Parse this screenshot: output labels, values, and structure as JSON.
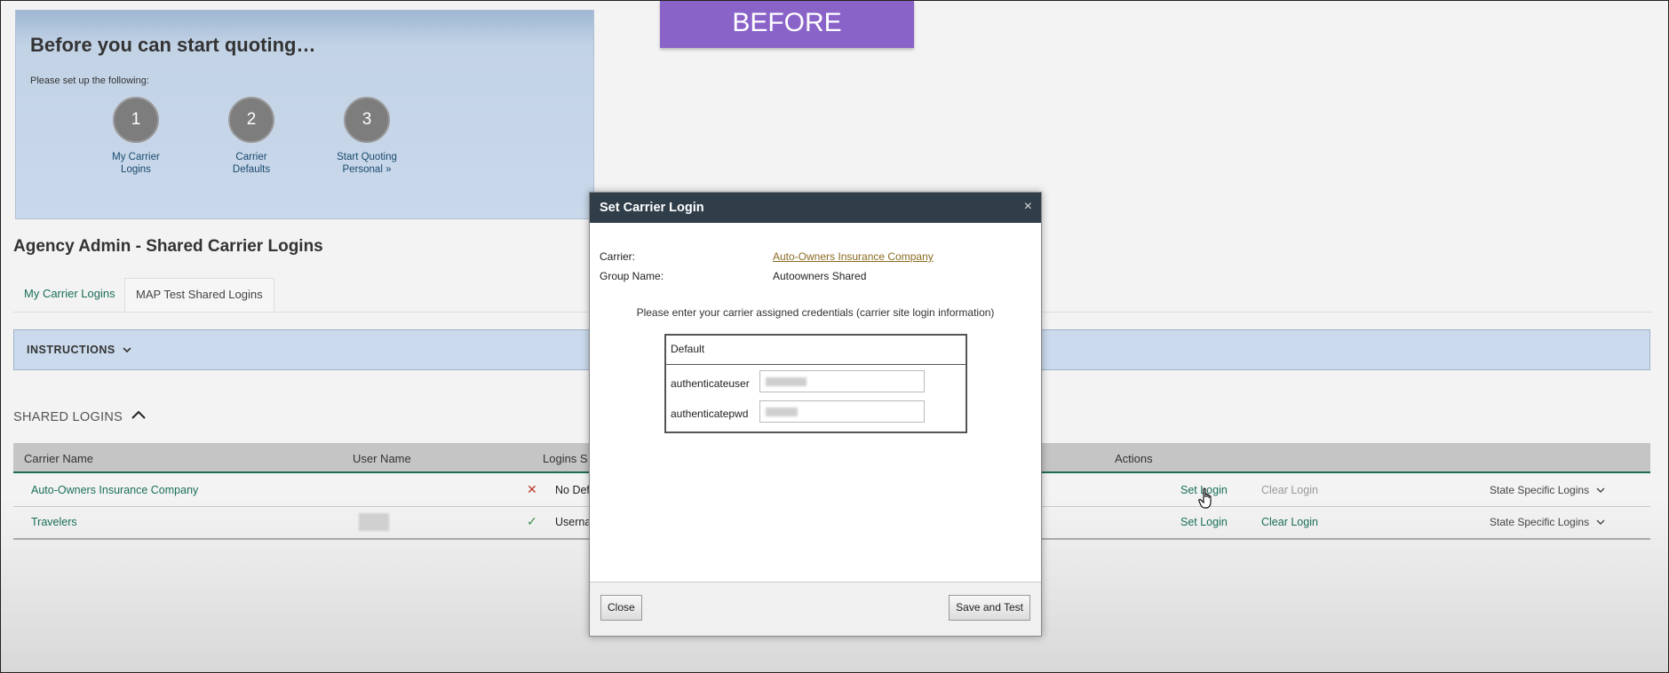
{
  "banner": "BEFORE",
  "setup": {
    "title": "Before you can start quoting…",
    "subtitle": "Please set up the following:",
    "steps": [
      {
        "num": "1",
        "line1": "My Carrier",
        "line2": "Logins"
      },
      {
        "num": "2",
        "line1": "Carrier",
        "line2": "Defaults"
      },
      {
        "num": "3",
        "line1": "Start Quoting",
        "line2": "Personal »"
      }
    ]
  },
  "page_title": "Agency Admin - Shared Carrier Logins",
  "tabs": [
    {
      "label": "My Carrier Logins"
    },
    {
      "label": "MAP Test Shared Logins"
    }
  ],
  "instructions_label": "INSTRUCTIONS",
  "shared_logins_label": "SHARED LOGINS",
  "table": {
    "headers": {
      "carrier": "Carrier Name",
      "user": "User Name",
      "status": "Logins S",
      "actions": "Actions"
    },
    "rows": [
      {
        "carrier": "Auto-Owners Insurance Company",
        "status_icon": "✕",
        "status_color": "#c0392b",
        "status_text": "No Def",
        "set_login": "Set Login",
        "clear_login": "Clear Login",
        "clear_enabled": false,
        "state": "State Specific Logins"
      },
      {
        "carrier": "Travelers",
        "status_icon": "✓",
        "status_color": "#3c8f4a",
        "status_text": "Userna",
        "set_login": "Set Login",
        "clear_login": "Clear Login",
        "clear_enabled": true,
        "state": "State Specific Logins"
      }
    ]
  },
  "modal": {
    "title": "Set Carrier Login",
    "close_x": "×",
    "carrier_label": "Carrier:",
    "carrier_value": "Auto-Owners Insurance Company",
    "group_label": "Group Name:",
    "group_value": "Autoowners Shared",
    "hint": "Please enter your carrier assigned credentials (carrier site login information)",
    "box_header": "Default",
    "fields": [
      {
        "label": "authenticateuser"
      },
      {
        "label": "authenticatepwd"
      }
    ],
    "close_button": "Close",
    "save_button": "Save and Test"
  },
  "colors": {
    "banner": "#8a63c9",
    "modal_header": "#303e4a",
    "accent_green": "#1a6e5a",
    "panel_blue": "#c9d8ea"
  },
  "icons": [
    "close-icon",
    "chevron-down-icon",
    "chevron-up-icon",
    "x-mark-icon",
    "check-icon",
    "hand-cursor-icon"
  ]
}
